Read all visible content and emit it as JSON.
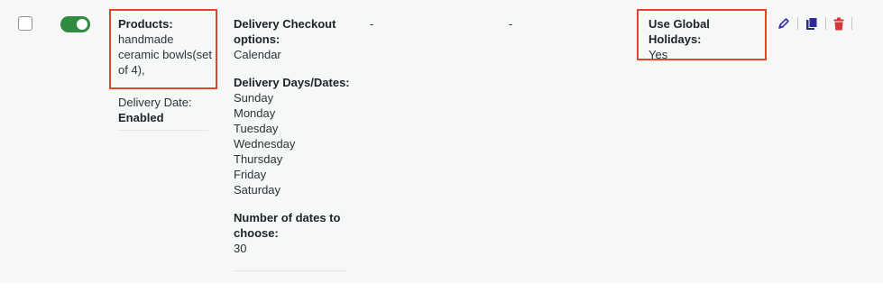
{
  "row": {
    "products_label": "Products:",
    "products_value": "handmade\nceramic bowls(set\nof 4),",
    "delivery_date_label": "Delivery Date:",
    "delivery_date_value": "Enabled",
    "checkout_label_line1": "Delivery Checkout",
    "checkout_label_line2": "options:",
    "checkout_value": "Calendar",
    "days_label": "Delivery Days/Dates:",
    "days": [
      "Sunday",
      "Monday",
      "Tuesday",
      "Wednesday",
      "Thursday",
      "Friday",
      "Saturday"
    ],
    "dates_label_line1": "Number of dates to",
    "dates_label_line2": "choose:",
    "dates_value": "30",
    "col3_value": "-",
    "col4_value": "-",
    "holidays_label": "Use Global Holidays:",
    "holidays_value": "Yes"
  },
  "toggle_state": "on",
  "colors": {
    "toggle_on": "#2e8b3f",
    "highlight_border": "#e0462a",
    "edit_icon": "#3b2fa0",
    "copy_icon": "#2b2c8f",
    "delete_icon": "#d63638"
  },
  "icons": [
    "pencil-icon",
    "copy-icon",
    "trash-icon"
  ]
}
